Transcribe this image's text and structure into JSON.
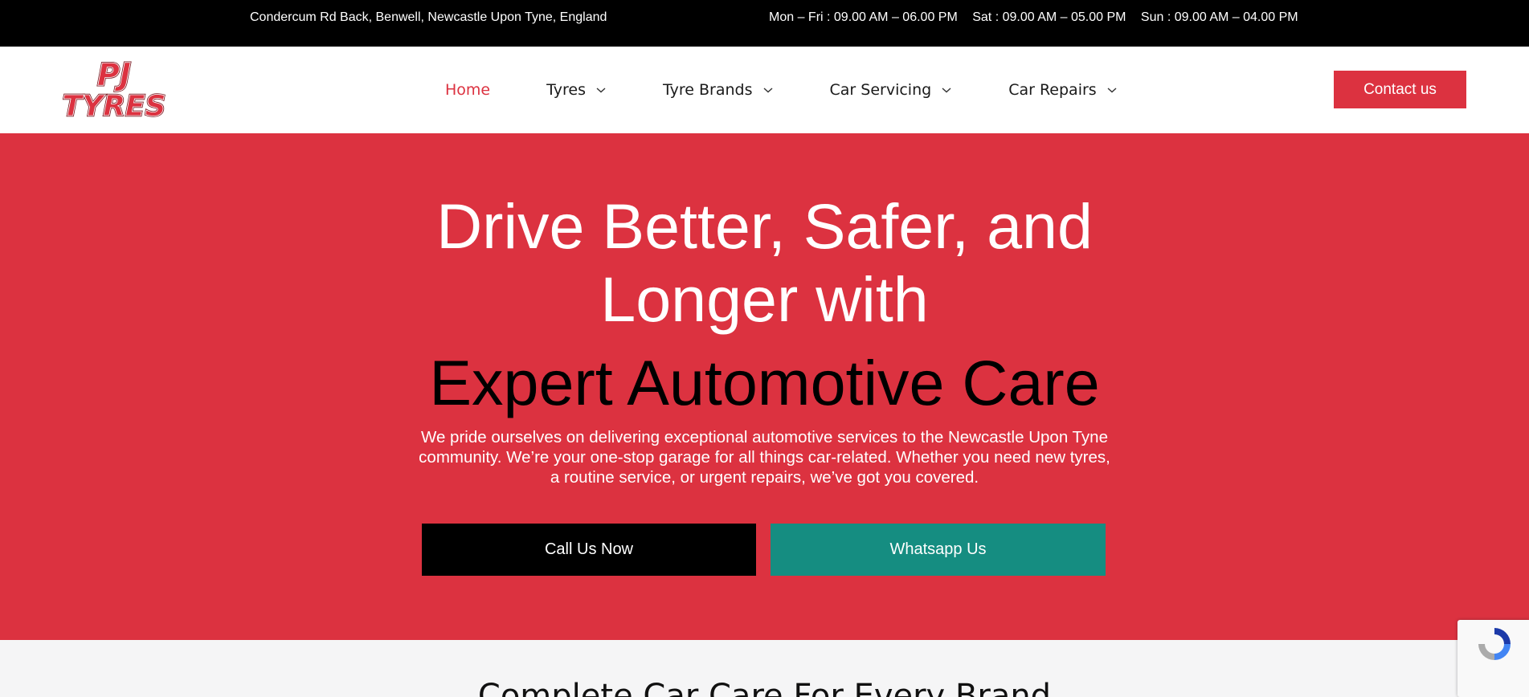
{
  "topbar": {
    "address": "Condercum Rd Back, Benwell, Newcastle Upon Tyne, England",
    "hours": [
      "Mon – Fri : 09.00 AM – 06.00 PM",
      "Sat : 09.00 AM – 05.00 PM",
      "Sun :  09.00 AM – 04.00 PM"
    ]
  },
  "header": {
    "logo_text": "PJ TYRES",
    "nav": [
      {
        "label": "Home",
        "active": true,
        "dropdown": false
      },
      {
        "label": "Tyres",
        "active": false,
        "dropdown": true
      },
      {
        "label": "Tyre Brands",
        "active": false,
        "dropdown": true
      },
      {
        "label": "Car Servicing",
        "active": false,
        "dropdown": true
      },
      {
        "label": "Car Repairs",
        "active": false,
        "dropdown": true
      }
    ],
    "contact_label": "Contact us"
  },
  "hero": {
    "title_line1": "Drive Better, Safer, and",
    "title_line2": "Longer with",
    "subtitle": "Expert Automotive Care",
    "description": "We pride ourselves on delivering exceptional automotive services to the Newcastle Upon Tyne community. We’re your one-stop garage for all things car-related. Whether you need new tyres, a routine service, or urgent repairs, we’ve got you covered.",
    "call_label": "Call Us Now",
    "whatsapp_label": "Whatsapp Us"
  },
  "section2": {
    "heading": "Complete Car Care For Every Brand"
  },
  "colors": {
    "brand_red": "#dc3240",
    "whatsapp_teal": "#158d81",
    "topbar_bg": "#000000"
  },
  "icons": {
    "dropdown": "chevron-down-icon",
    "recaptcha": "recaptcha-icon"
  }
}
